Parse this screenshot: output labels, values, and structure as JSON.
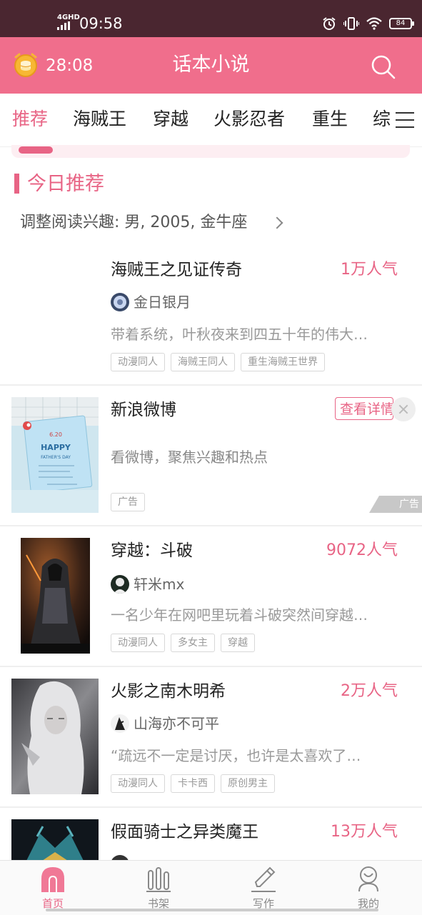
{
  "status_bar": {
    "network": "4GHD",
    "time": "09:58",
    "battery": "84"
  },
  "app_bar": {
    "timer": "28:08",
    "title": "话本小说"
  },
  "tabs": [
    {
      "label": "推荐",
      "active": true
    },
    {
      "label": "海贼王",
      "active": false
    },
    {
      "label": "穿越",
      "active": false
    },
    {
      "label": "火影忍者",
      "active": false
    },
    {
      "label": "重生",
      "active": false
    },
    {
      "label": "综",
      "active": false
    }
  ],
  "section": {
    "title": "今日推荐",
    "interest": "调整阅读兴趣: 男, 2005, 金牛座"
  },
  "books": [
    {
      "title": "海贼王之见证传奇",
      "popularity": "1万人气",
      "author": "金日银月",
      "description": "带着系统，叶秋夜来到四五十年的伟大…",
      "tags": [
        "动漫同人",
        "海贼王同人",
        "重生海贼王世界"
      ]
    },
    {
      "title": "穿越：斗破",
      "popularity": "9072人气",
      "author": "轩米mx",
      "description": "一名少年在网吧里玩着斗破突然间穿越…",
      "tags": [
        "动漫同人",
        "多女主",
        "穿越"
      ]
    },
    {
      "title": "火影之南木明希",
      "popularity": "2万人气",
      "author": "山海亦不可平",
      "description": "“疏远不一定是讨厌，也许是太喜欢了…",
      "tags": [
        "动漫同人",
        "卡卡西",
        "原创男主"
      ]
    },
    {
      "title": "假面骑士之异类魔王",
      "popularity": "13万人气"
    }
  ],
  "ad": {
    "title": "新浪微博",
    "button": "查看详情",
    "description": "看微博，聚焦兴趣和热点",
    "tag": "广告",
    "mark": "广告",
    "cover_card": {
      "date": "6.20",
      "heading": "HAPPY",
      "subheading": "FATHER'S DAY"
    }
  },
  "bottom_nav": [
    {
      "label": "首页",
      "icon": "home-icon",
      "active": true
    },
    {
      "label": "书架",
      "icon": "bookshelf-icon",
      "active": false
    },
    {
      "label": "写作",
      "icon": "pen-icon",
      "active": false
    },
    {
      "label": "我的",
      "icon": "profile-icon",
      "active": false
    }
  ],
  "colors": {
    "accent": "#e86485",
    "app_bar": "#f06e8c",
    "status_bar": "#4a2630"
  }
}
